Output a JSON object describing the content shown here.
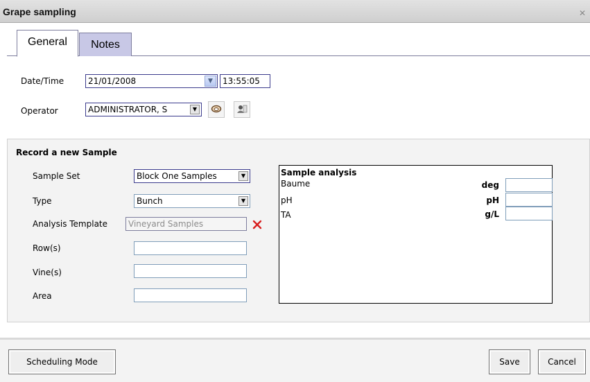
{
  "window": {
    "title": "Grape sampling"
  },
  "tabs": [
    {
      "label": "General",
      "active": true
    },
    {
      "label": "Notes",
      "active": false
    }
  ],
  "general": {
    "datetime_label": "Date/Time",
    "date_value": "21/01/2008",
    "time_value": "13:55:05",
    "operator_label": "Operator",
    "operator_value": "ADMINISTRATOR, S"
  },
  "sample": {
    "title": "Record a new Sample",
    "sample_set_label": "Sample Set",
    "sample_set_value": "Block One Samples",
    "type_label": "Type",
    "type_value": "Bunch",
    "template_label": "Analysis Template",
    "template_value": "Vineyard Samples",
    "rows_label": "Row(s)",
    "rows_value": "",
    "vines_label": "Vine(s)",
    "vines_value": "",
    "area_label": "Area",
    "area_value": ""
  },
  "analysis": {
    "title": "Sample analysis",
    "rows": [
      {
        "name": "Baume",
        "unit": "deg",
        "value": ""
      },
      {
        "name": "pH",
        "unit": "pH",
        "value": ""
      },
      {
        "name": "TA",
        "unit": "g/L",
        "value": ""
      }
    ]
  },
  "footer": {
    "scheduling_label": "Scheduling Mode",
    "save_label": "Save",
    "cancel_label": "Cancel"
  },
  "icons": {
    "close": "close-icon",
    "dropdown": "chevron-down-icon",
    "operator_lookup": "operator-lookup-icon",
    "operator_badge": "badge-icon",
    "clear": "clear-x-icon"
  },
  "colors": {
    "title_bar": "#d6d6d6",
    "inactive_tab": "#c8c8e6",
    "field_border": "#3a3a8c",
    "clear_icon": "#d81e1e"
  }
}
